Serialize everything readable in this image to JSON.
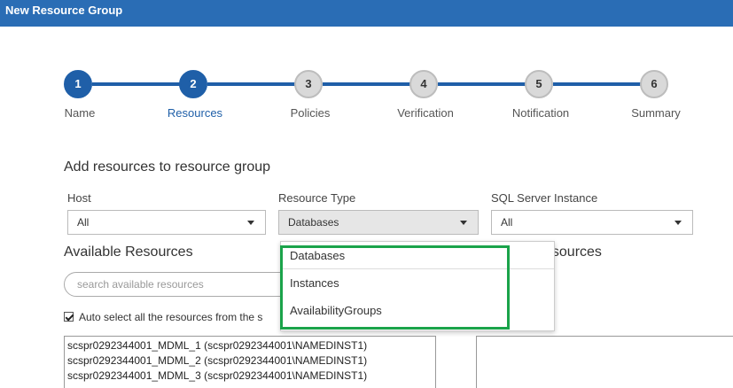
{
  "window": {
    "title": "New Resource Group"
  },
  "stepper": {
    "steps": [
      {
        "number": "1",
        "label": "Name"
      },
      {
        "number": "2",
        "label": "Resources"
      },
      {
        "number": "3",
        "label": "Policies"
      },
      {
        "number": "4",
        "label": "Verification"
      },
      {
        "number": "5",
        "label": "Notification"
      },
      {
        "number": "6",
        "label": "Summary"
      }
    ]
  },
  "form": {
    "section_title": "Add resources to resource group",
    "host": {
      "label": "Host",
      "value": "All"
    },
    "resource_type": {
      "label": "Resource Type",
      "value": "Databases"
    },
    "sql_instance": {
      "label": "SQL Server Instance",
      "value": "All"
    }
  },
  "available": {
    "title": "Available Resources",
    "search_placeholder": "search available resources",
    "autoselect_label": "Auto select all the resources from the s",
    "items": [
      "scspr0292344001_MDML_1 (scspr0292344001\\NAMEDINST1)",
      "scspr0292344001_MDML_2 (scspr0292344001\\NAMEDINST1)",
      "scspr0292344001_MDML_3 (scspr0292344001\\NAMEDINST1)"
    ]
  },
  "selected": {
    "title_fragment": "esources"
  },
  "dropdown": {
    "options": [
      "Databases",
      "Instances",
      "AvailabilityGroups"
    ]
  },
  "colors": {
    "accent": "#1f5fa8",
    "titlebar": "#2a6db5",
    "highlight": "#1aa34a"
  }
}
